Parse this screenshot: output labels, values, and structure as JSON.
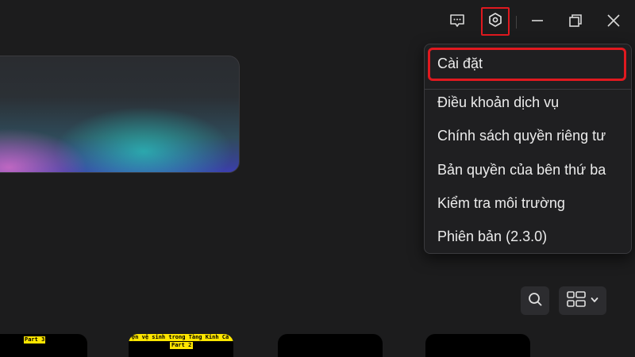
{
  "titlebar": {
    "icons": [
      "feedback-icon",
      "settings-icon",
      "minimize-icon",
      "restore-icon",
      "close-icon"
    ]
  },
  "menu": {
    "items": [
      {
        "label": "Cài đặt"
      },
      {
        "label": "Điều khoản dịch vụ"
      },
      {
        "label": "Chính sách quyền riêng tư"
      },
      {
        "label": "Bản quyền của bên thứ ba"
      },
      {
        "label": "Kiểm tra môi trường"
      },
      {
        "label": "Phiên bản (2.3.0)"
      }
    ]
  },
  "toolbar": {
    "icons": [
      "search-icon",
      "grid-view-icon",
      "chevron-down-icon"
    ]
  },
  "thumbnails": [
    {
      "caption_lines": [
        "Part 3"
      ]
    },
    {
      "caption_lines": [
        "ợn vệ sinh trong Tàng Kinh Cá",
        "Part 2"
      ]
    },
    {
      "caption_lines": []
    },
    {
      "caption_lines": []
    }
  ],
  "colors": {
    "background": "#1c1c1d",
    "highlight": "#e0191f",
    "caption_bg": "#ffe600"
  }
}
